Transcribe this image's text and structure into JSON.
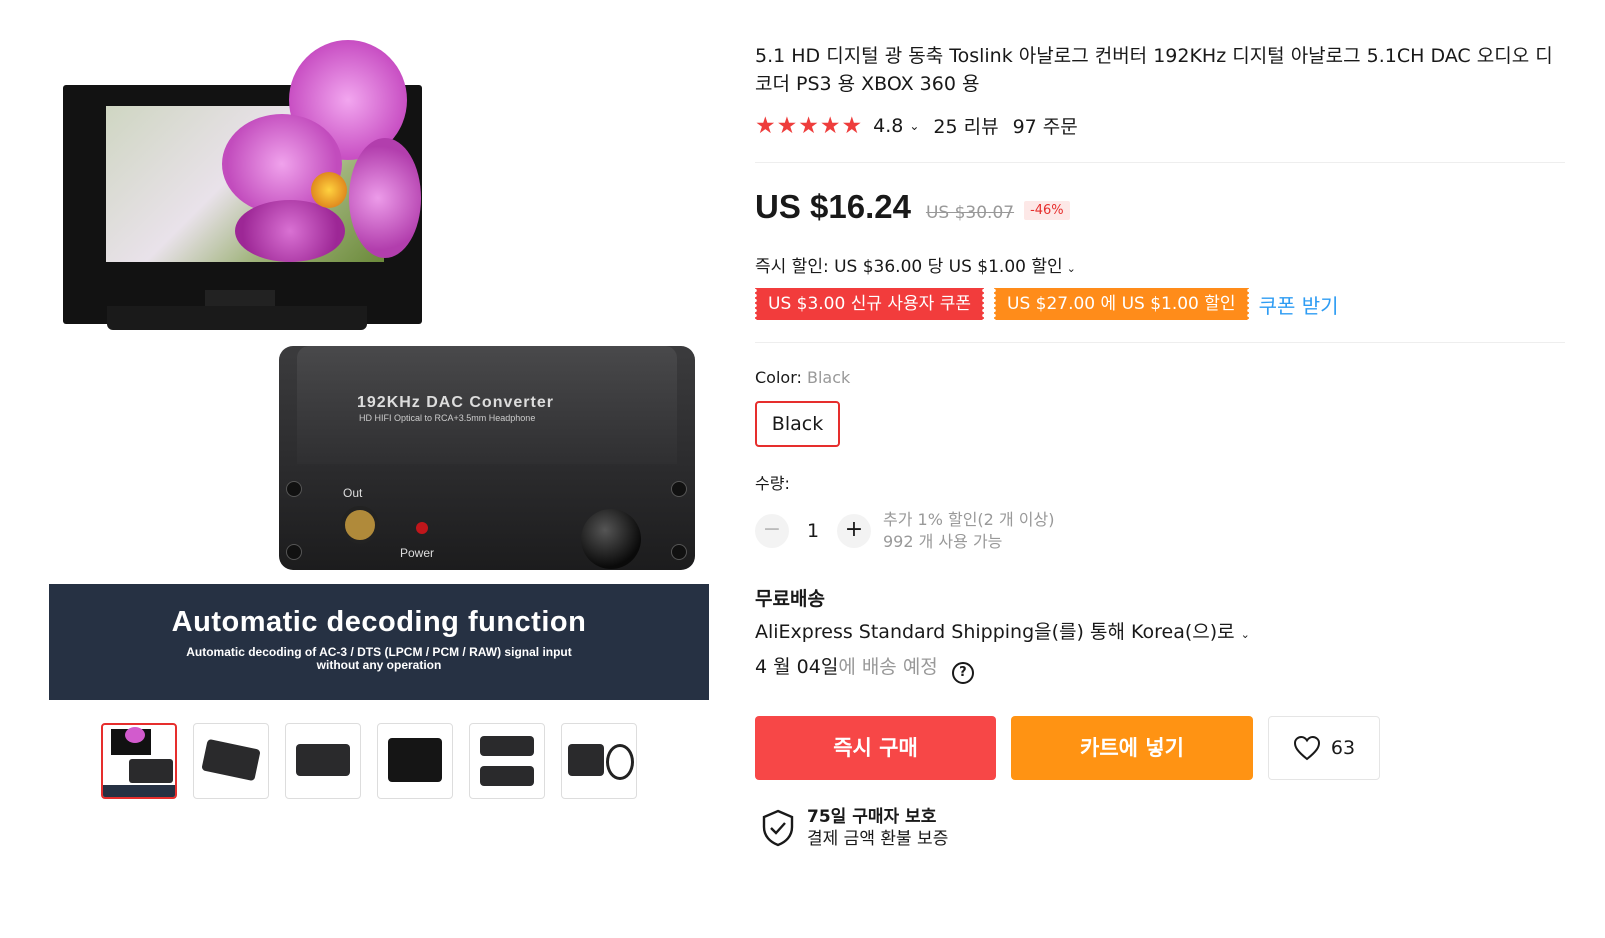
{
  "gallery": {
    "banner_title": "Automatic decoding function",
    "banner_subtitle": "Automatic decoding of AC-3 / DTS (LPCM / PCM / RAW) signal input without any operation",
    "device_title": "192KHz DAC Converter",
    "device_subtitle": "HD HIFI Optical to RCA+3.5mm Headphone",
    "device_out_label": "Out",
    "device_power_label": "Power",
    "thumbnails": 6,
    "active_thumbnail": 1
  },
  "product": {
    "title": "5.1 HD 디지털 광 동축 Toslink 아날로그 컨버터 192KHz 디지털 아날로그 5.1CH DAC 오디오 디코더 PS3 용 XBOX 360 용",
    "rating": "4.8",
    "star_count": 5,
    "reviews": "25 리뷰",
    "orders": "97 주문"
  },
  "price": {
    "current": "US $16.24",
    "original": "US $30.07",
    "discount": "-46%"
  },
  "instant_discount": "즉시 할인: US $36.00 당 US $1.00 할인",
  "coupons": {
    "new_user": "US $3.00 신규 사용자 쿠폰",
    "threshold": "US $27.00 에 US $1.00 할인",
    "get_link": "쿠폰 받기"
  },
  "variant": {
    "label": "Color: ",
    "selected": "Black",
    "option": "Black"
  },
  "quantity": {
    "label": "수량:",
    "value": "1",
    "minus": "−",
    "plus": "+",
    "bulk_hint": "추가 1% 할인(2 개 이상)",
    "available": "992 개 사용 가능"
  },
  "shipping": {
    "title": "무료배송",
    "method": "AliExpress Standard Shipping을(를) 통해 Korea(으)로",
    "date": "4 월 04일",
    "date_suffix": "에 배송 예정"
  },
  "actions": {
    "buy_now": "즉시 구매",
    "add_to_cart": "카트에 넣기",
    "wishlist_count": "63"
  },
  "protection": {
    "title": "75일 구매자 보호",
    "subtitle": "결제 금액 환불 보증"
  },
  "colors": {
    "accent_red": "#e62e2d",
    "buy_red": "#f74747",
    "cart_orange": "#ff9313",
    "link_blue": "#2e9cf3"
  }
}
